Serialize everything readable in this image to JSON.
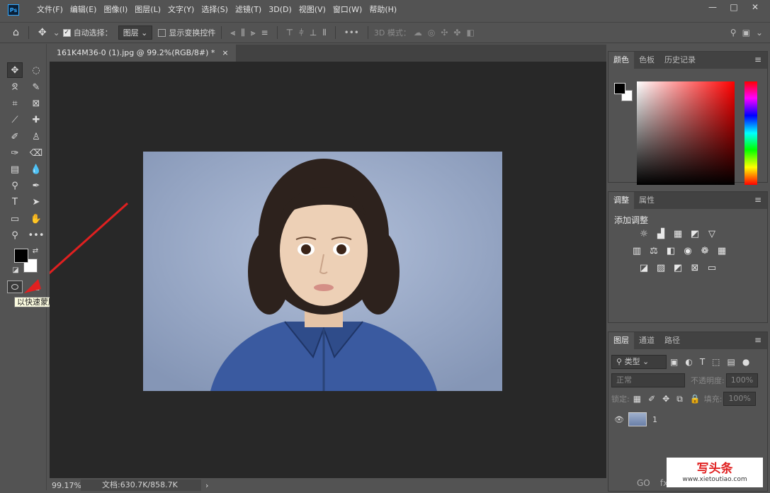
{
  "app": {
    "logo": "Ps"
  },
  "menu": [
    "文件(F)",
    "编辑(E)",
    "图像(I)",
    "图层(L)",
    "文字(Y)",
    "选择(S)",
    "滤镜(T)",
    "3D(D)",
    "视图(V)",
    "窗口(W)",
    "帮助(H)"
  ],
  "window_controls": {
    "minimize": "—",
    "maximize": "□",
    "close": "✕"
  },
  "options": {
    "auto_select_label": "自动选择：",
    "auto_select_checked": "✓",
    "layer_select": "图层",
    "show_transform_label": "显示变换控件",
    "mode_3d_label": "3D 模式："
  },
  "document": {
    "tab_title": "161K4M36-0 (1).jpg @ 99.2%(RGB/8#) *",
    "tab_close": "×"
  },
  "tooltip": "以快速蒙版模式编辑 (Q)",
  "status": {
    "zoom": "99.17%",
    "doc_info": "文档:630.7K/858.7K",
    "arrow": "›"
  },
  "color_panel": {
    "tabs": [
      "颜色",
      "色板",
      "历史记录"
    ]
  },
  "adjust_panel": {
    "tabs": [
      "调整",
      "属性"
    ],
    "title": "添加调整"
  },
  "layers_panel": {
    "tabs": [
      "图层",
      "通道",
      "路径"
    ],
    "filter": "类型",
    "blend": "正常",
    "opacity_label": "不透明度:",
    "opacity_value": "100%",
    "lock_label": "锁定:",
    "fill_label": "填充:",
    "fill_value": "100%",
    "layers": [
      {
        "name": "1",
        "visible": "👁"
      }
    ],
    "footer": [
      "GO",
      "fx"
    ]
  },
  "watermark": {
    "title": "写头条",
    "url": "www.xietoutiao.com"
  },
  "colors": {
    "accent": "#31a8ff",
    "arrow": "#e02020"
  }
}
